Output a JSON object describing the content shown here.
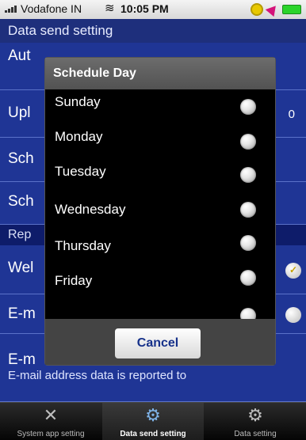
{
  "status": {
    "carrier": "Vodafone IN",
    "time": "10:05 PM"
  },
  "header": {
    "title": "Data send setting"
  },
  "rows": [
    {
      "label": "Aut"
    },
    {
      "label": "Upl",
      "value": "0"
    },
    {
      "label": "Sch"
    },
    {
      "label": "Sch"
    },
    {
      "label": "Wel"
    },
    {
      "label": "E-m"
    },
    {
      "label": "E-m"
    }
  ],
  "section": {
    "label": "Rep"
  },
  "subtext": "E-mail address data is reported to",
  "modal": {
    "title": "Schedule Day",
    "days": [
      "Sunday",
      "Monday",
      "Tuesday",
      "Wednesday",
      "Thursday",
      "Friday"
    ],
    "cancel_label": "Cancel"
  },
  "tabs": [
    {
      "label": "System app setting",
      "icon": "tools-icon"
    },
    {
      "label": "Data send setting",
      "icon": "gears-icon"
    },
    {
      "label": "Data setting",
      "icon": "gear-icon"
    }
  ]
}
